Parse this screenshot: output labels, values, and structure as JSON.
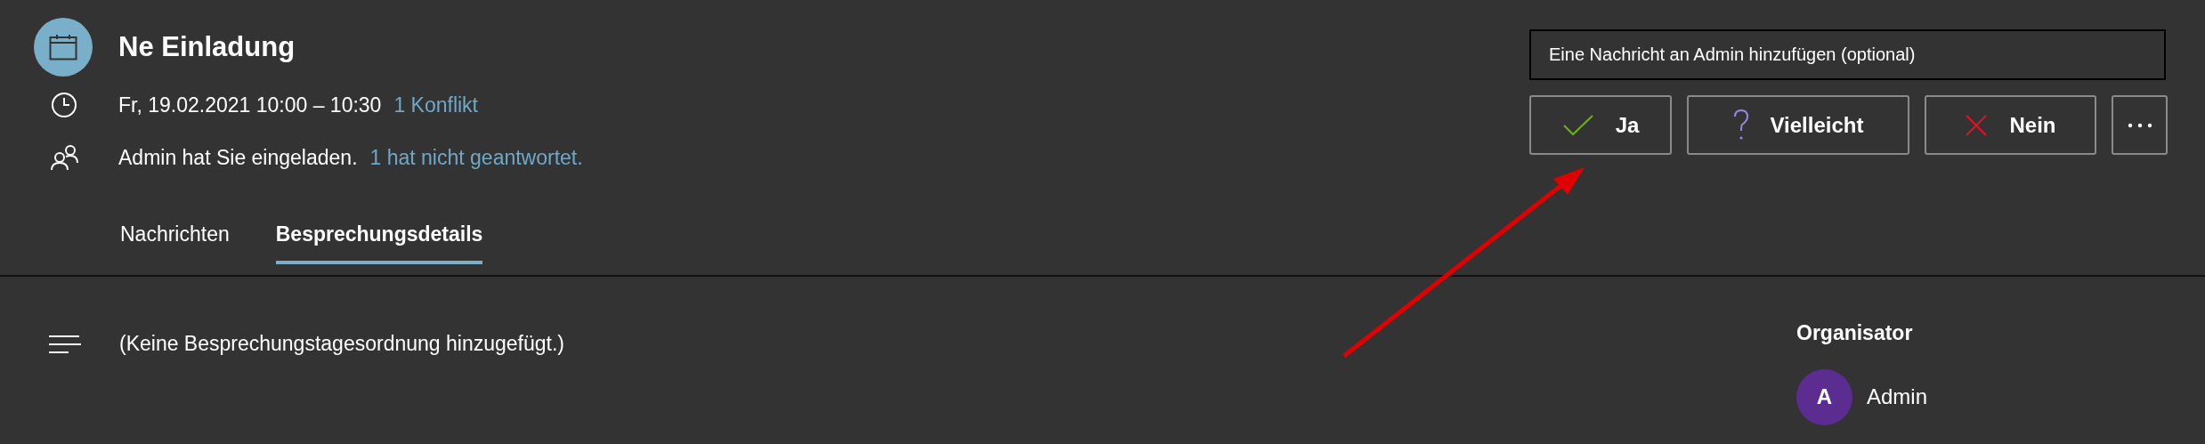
{
  "event": {
    "title": "Ne Einladung",
    "time": "Fr, 19.02.2021 10:00 – 10:30",
    "conflict_link": "1 Konflikt",
    "invite_text": "Admin hat Sie eingeladen.",
    "response_link": "1 hat nicht geantwortet."
  },
  "tabs": [
    {
      "label": "Nachrichten",
      "selected": false
    },
    {
      "label": "Besprechungsdetails",
      "selected": true
    }
  ],
  "message_field": {
    "placeholder": "Eine Nachricht an Admin hinzufügen (optional)"
  },
  "responses": [
    {
      "kind": "accept",
      "label": "Ja"
    },
    {
      "kind": "tentative",
      "label": "Vielleicht"
    },
    {
      "kind": "decline",
      "label": "Nein"
    },
    {
      "kind": "more"
    }
  ],
  "agenda": "(Keine Besprechungstagesordnung hinzugefügt.)",
  "organizer": {
    "heading": "Organisator",
    "initial": "A",
    "name": "Admin"
  }
}
